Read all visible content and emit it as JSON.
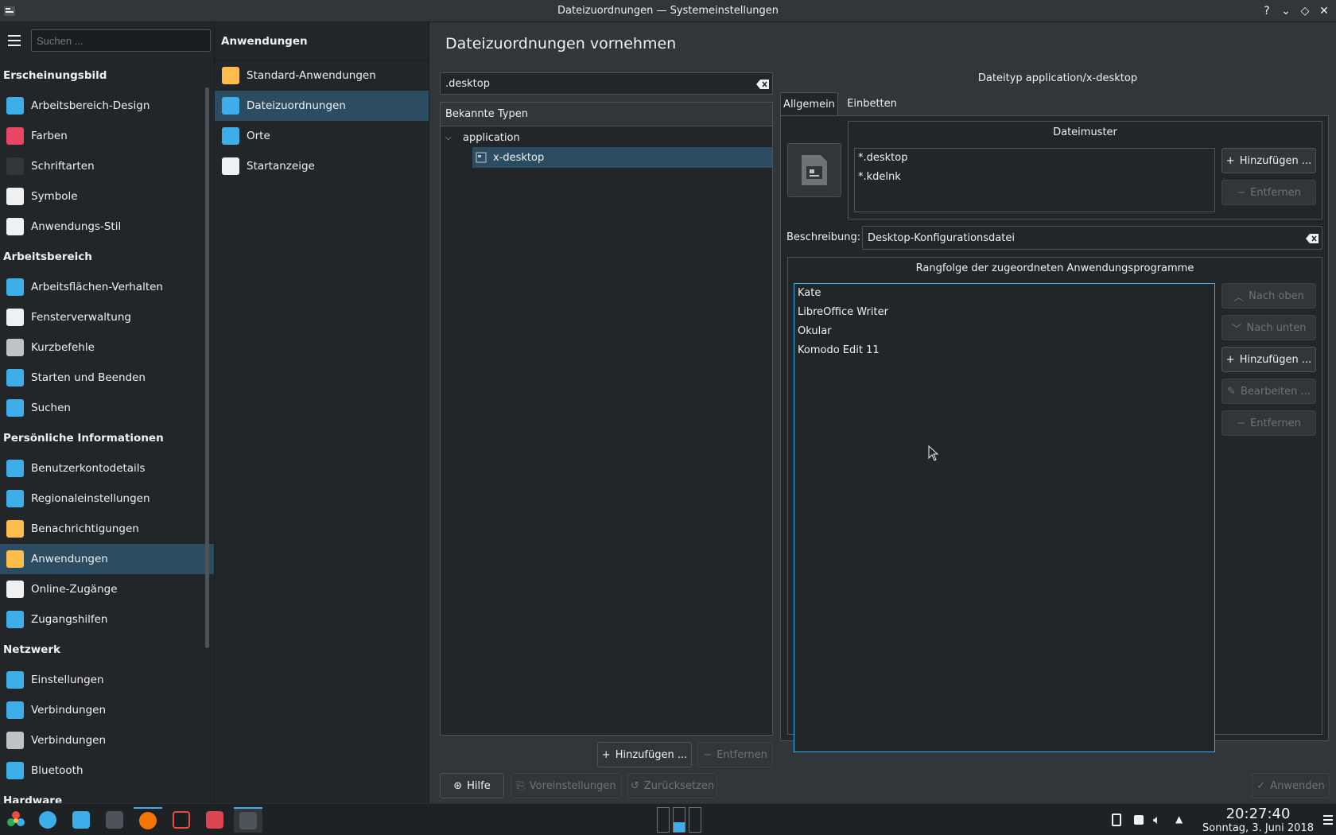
{
  "window": {
    "title": "Dateizuordnungen — Systemeinstellungen",
    "buttons": [
      "?",
      "⌄",
      "◇",
      "✕"
    ]
  },
  "sidebar": {
    "search_placeholder": "Suchen ...",
    "categories": [
      {
        "label": "Erscheinungsbild",
        "items": [
          {
            "label": "Arbeitsbereich-Design",
            "icon": "workspace-theme-icon",
            "color": "#3daee9"
          },
          {
            "label": "Farben",
            "icon": "colors-icon",
            "color": "#e94565"
          },
          {
            "label": "Schriftarten",
            "icon": "fonts-icon",
            "color": "#31363b"
          },
          {
            "label": "Symbole",
            "icon": "icons-icon",
            "color": "#eff0f1"
          },
          {
            "label": "Anwendungs-Stil",
            "icon": "app-style-icon",
            "color": "#eff0f1"
          }
        ]
      },
      {
        "label": "Arbeitsbereich",
        "items": [
          {
            "label": "Arbeitsflächen-Verhalten",
            "icon": "desktop-behavior-icon",
            "color": "#3daee9"
          },
          {
            "label": "Fensterverwaltung",
            "icon": "window-management-icon",
            "color": "#eff0f1"
          },
          {
            "label": "Kurzbefehle",
            "icon": "shortcuts-icon",
            "color": "#bdc3c7"
          },
          {
            "label": "Starten und Beenden",
            "icon": "startup-shutdown-icon",
            "color": "#3daee9"
          },
          {
            "label": "Suchen",
            "icon": "search-settings-icon",
            "color": "#3daee9"
          }
        ]
      },
      {
        "label": "Persönliche Informationen",
        "items": [
          {
            "label": "Benutzerkontodetails",
            "icon": "user-account-icon",
            "color": "#3daee9"
          },
          {
            "label": "Regionaleinstellungen",
            "icon": "regional-icon",
            "color": "#3daee9"
          },
          {
            "label": "Benachrichtigungen",
            "icon": "notifications-icon",
            "color": "#fdbc4b"
          },
          {
            "label": "Anwendungen",
            "icon": "applications-star-icon",
            "color": "#fdbc4b",
            "active": true
          },
          {
            "label": "Online-Zugänge",
            "icon": "online-accounts-icon",
            "color": "#eff0f1"
          },
          {
            "label": "Zugangshilfen",
            "icon": "accessibility-icon",
            "color": "#3daee9"
          }
        ]
      },
      {
        "label": "Netzwerk",
        "items": [
          {
            "label": "Einstellungen",
            "icon": "network-settings-icon",
            "color": "#3daee9"
          },
          {
            "label": "Verbindungen",
            "icon": "connections-icon",
            "color": "#3daee9"
          },
          {
            "label": "Verbindungen",
            "icon": "kde-connect-icon",
            "color": "#bdc3c7"
          },
          {
            "label": "Bluetooth",
            "icon": "bluetooth-icon",
            "color": "#3daee9"
          }
        ]
      },
      {
        "label": "Hardware",
        "items": []
      }
    ]
  },
  "subpanel": {
    "header": "Anwendungen",
    "items": [
      {
        "label": "Standard-Anwendungen",
        "icon": "star-icon",
        "color": "#fdbc4b"
      },
      {
        "label": "Dateizuordnungen",
        "icon": "file-associations-icon",
        "color": "#3daee9",
        "active": true
      },
      {
        "label": "Orte",
        "icon": "folder-icon",
        "color": "#3daee9"
      },
      {
        "label": "Startanzeige",
        "icon": "launch-feedback-icon",
        "color": "#eff0f1"
      }
    ]
  },
  "main": {
    "page_title": "Dateizuordnungen vornehmen",
    "filter_value": ".desktop",
    "known_types_header": "Bekannte Typen",
    "tree": {
      "group": "application",
      "child": "x-desktop"
    },
    "add_button": "Hinzufügen ...",
    "remove_button": "Entfernen",
    "filetype_heading": "Dateityp application/x-desktop",
    "tabs": [
      "Allgemein",
      "Einbetten"
    ],
    "patterns_title": "Dateimuster",
    "patterns": [
      "*.desktop",
      "*.kdelnk"
    ],
    "patterns_add": "Hinzufügen ...",
    "patterns_remove": "Entfernen",
    "description_label": "Beschreibung:",
    "description_value": "Desktop-Konfigurationsdatei",
    "apps_title": "Rangfolge der zugeordneten Anwendungsprogramme",
    "apps": [
      "Kate",
      "LibreOffice Writer",
      "Okular",
      "Komodo Edit 11"
    ],
    "apps_buttons": {
      "up": "Nach oben",
      "down": "Nach unten",
      "add": "Hinzufügen ...",
      "edit": "Bearbeiten ...",
      "remove": "Entfernen"
    },
    "footer": {
      "help": "Hilfe",
      "defaults": "Voreinstellungen",
      "reset": "Zurücksetzen",
      "apply": "Anwenden"
    }
  },
  "taskbar": {
    "time": "20:27:40",
    "date": "Sonntag, 3. Juni 2018"
  }
}
